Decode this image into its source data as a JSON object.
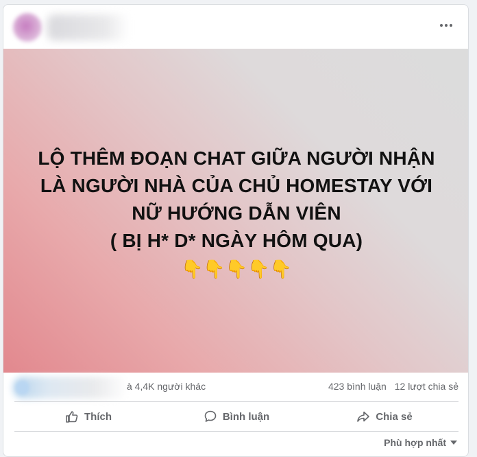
{
  "post": {
    "author_name": "",
    "headline_lines": [
      "LỘ THÊM ĐOẠN CHAT GIỮA NGƯỜI NHẬN",
      "LÀ NGƯỜI NHÀ CỦA CHỦ HOMESTAY VỚI",
      "NỮ HƯỚNG DẪN VIÊN",
      "( BỊ H* D* NGÀY HÔM QUA)"
    ],
    "emoji": "👇👇👇👇👇",
    "emoji_icon": "backhand-index-pointing-down"
  },
  "reactions": {
    "others_text": "à 4,4K người khác",
    "comments": "423 bình luận",
    "shares": "12 lượt chia sẻ"
  },
  "actions": {
    "like": "Thích",
    "comment": "Bình luận",
    "share": "Chia sẻ"
  },
  "sort": {
    "label": "Phù hợp nhất"
  },
  "colors": {
    "muted_text": "#65676b",
    "divider": "#ced0d4"
  }
}
